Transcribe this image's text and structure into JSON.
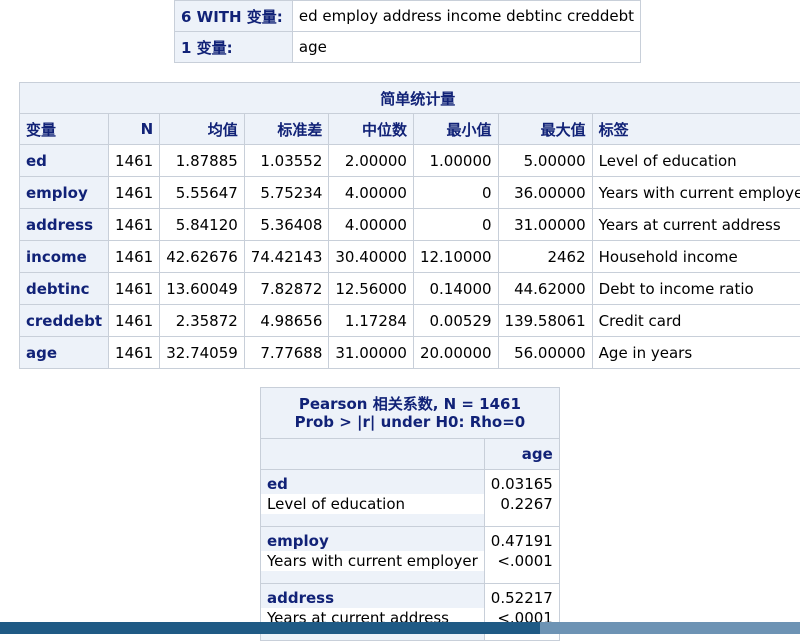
{
  "vars": {
    "with_label": "6 WITH 变量:",
    "with_value": "ed employ address income debtinc creddebt",
    "var_label": "1 变量:",
    "var_value": "age"
  },
  "stats": {
    "caption": "简单统计量",
    "headers": [
      "变量",
      "N",
      "均值",
      "标准差",
      "中位数",
      "最小值",
      "最大值",
      "标签"
    ],
    "rows": [
      {
        "var": "ed",
        "n": "1461",
        "mean": "1.87885",
        "std": "1.03552",
        "median": "2.00000",
        "min": "1.00000",
        "max": "5.00000",
        "label": "Level of education"
      },
      {
        "var": "employ",
        "n": "1461",
        "mean": "5.55647",
        "std": "5.75234",
        "median": "4.00000",
        "min": "0",
        "max": "36.00000",
        "label": "Years with current employer"
      },
      {
        "var": "address",
        "n": "1461",
        "mean": "5.84120",
        "std": "5.36408",
        "median": "4.00000",
        "min": "0",
        "max": "31.00000",
        "label": "Years at current address"
      },
      {
        "var": "income",
        "n": "1461",
        "mean": "42.62676",
        "std": "74.42143",
        "median": "30.40000",
        "min": "12.10000",
        "max": "2462",
        "label": "Household income"
      },
      {
        "var": "debtinc",
        "n": "1461",
        "mean": "13.60049",
        "std": "7.82872",
        "median": "12.56000",
        "min": "0.14000",
        "max": "44.62000",
        "label": "Debt to income ratio"
      },
      {
        "var": "creddebt",
        "n": "1461",
        "mean": "2.35872",
        "std": "4.98656",
        "median": "1.17284",
        "min": "0.00529",
        "max": "139.58061",
        "label": "Credit card"
      },
      {
        "var": "age",
        "n": "1461",
        "mean": "32.74059",
        "std": "7.77688",
        "median": "31.00000",
        "min": "20.00000",
        "max": "56.00000",
        "label": "Age in years"
      }
    ]
  },
  "pearson": {
    "caption_line1": "Pearson 相关系数, N = 1461",
    "caption_line2": "Prob > |r| under H0: Rho=0",
    "col_header": "age",
    "rows": [
      {
        "var": "ed",
        "label": "Level of education",
        "r": "0.03165",
        "p": "0.2267"
      },
      {
        "var": "employ",
        "label": "Years with current employer",
        "r": "0.47191",
        "p": "<.0001"
      },
      {
        "var": "address",
        "label": "Years at current address",
        "r": "0.52217",
        "p": "<.0001"
      }
    ]
  }
}
